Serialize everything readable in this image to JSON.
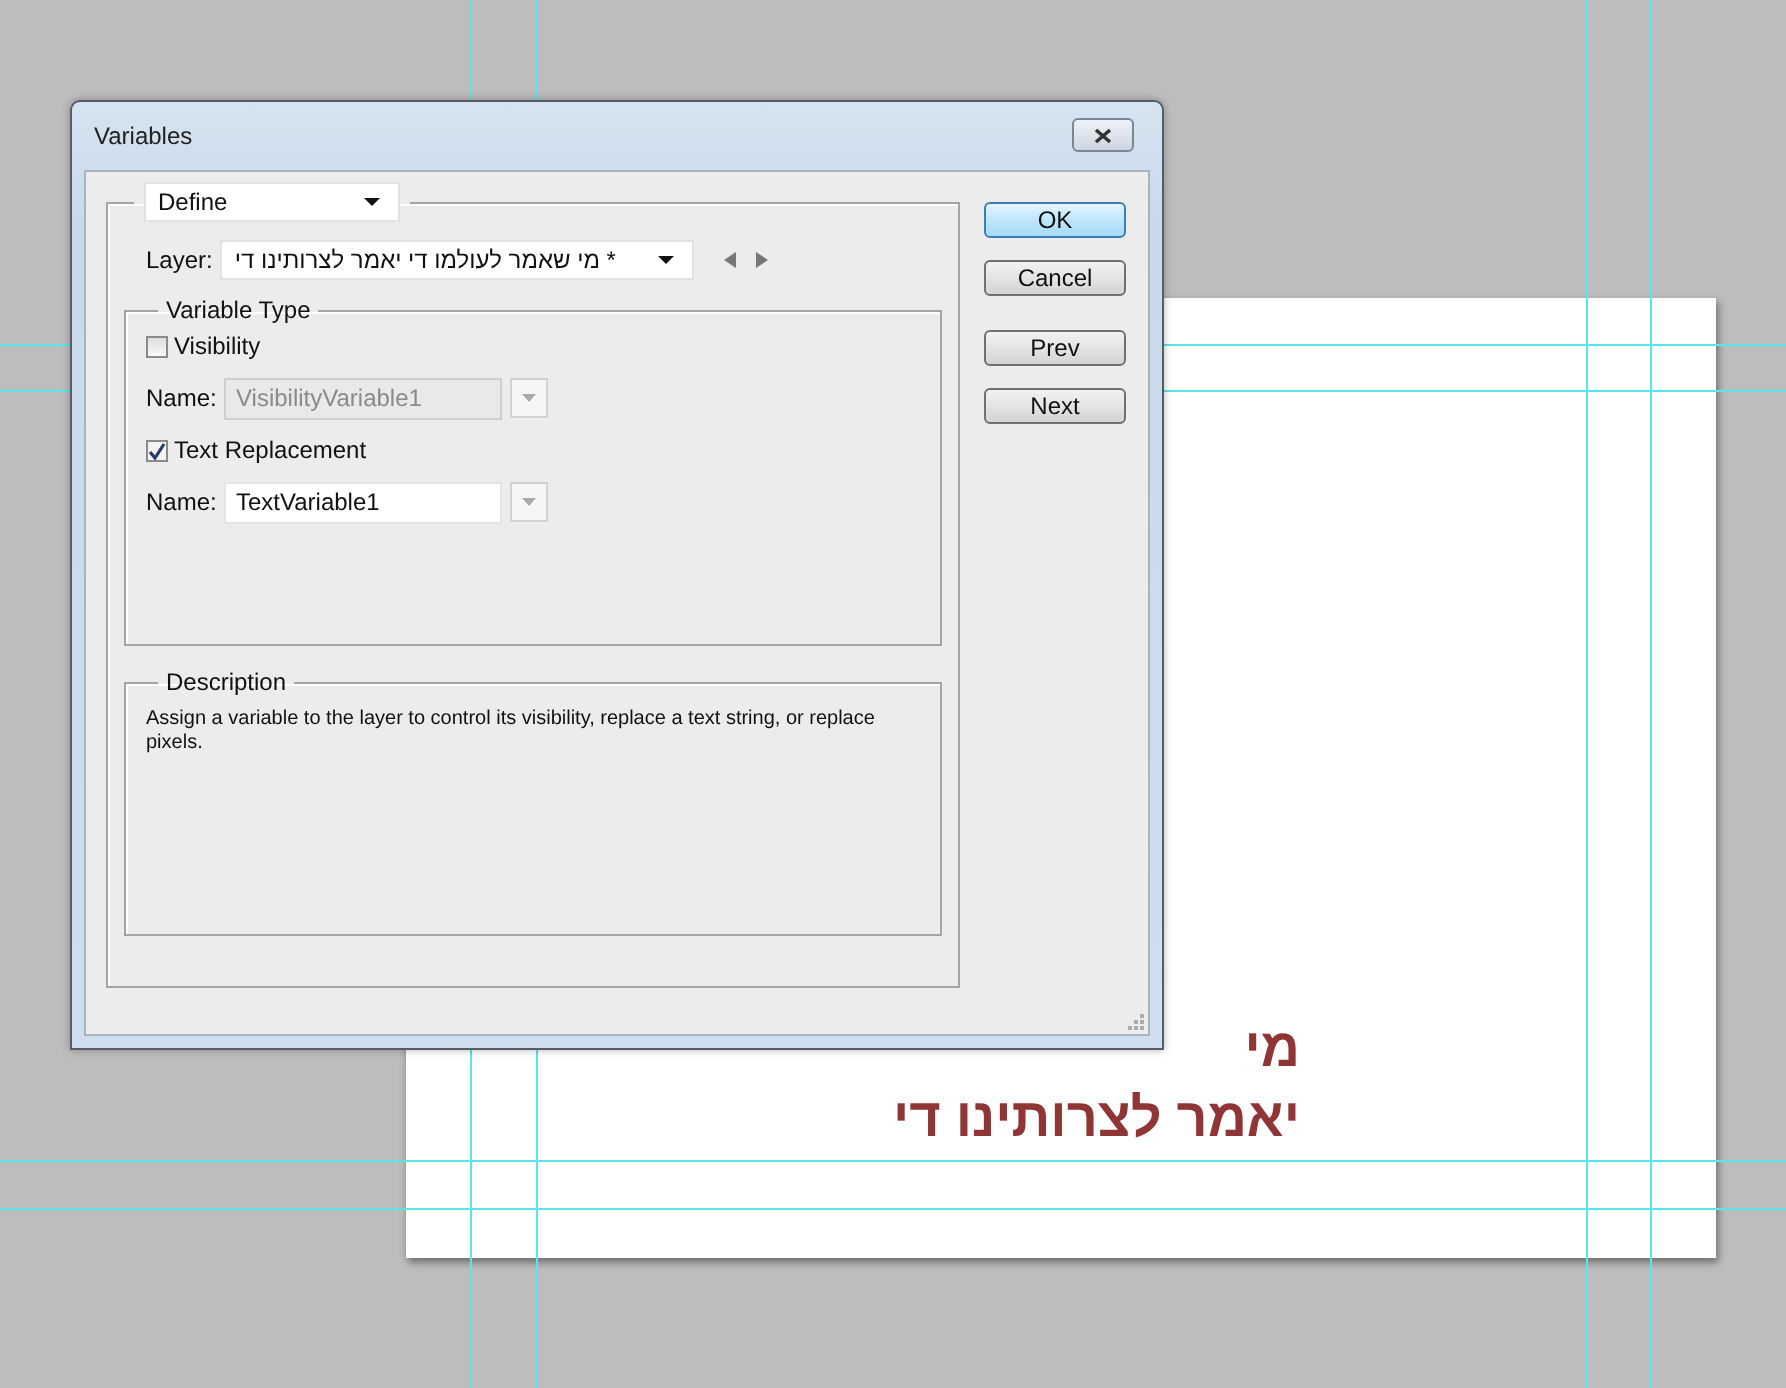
{
  "window": {
    "title": "Variables"
  },
  "mode_dropdown": {
    "value": "Define"
  },
  "layer": {
    "label": "Layer:",
    "value": "מי שאמר לעולמו די יאמר לצרותינו די *"
  },
  "variable_type": {
    "title": "Variable Type",
    "options": [
      {
        "label": "Visibility",
        "checked": false,
        "name_label": "Name:",
        "name_value": "VisibilityVariable1",
        "name_disabled": true
      },
      {
        "label": "Text Replacement",
        "checked": true,
        "name_label": "Name:",
        "name_value": "TextVariable1",
        "name_disabled": false
      }
    ]
  },
  "description": {
    "title": "Description",
    "text": "Assign a variable to the layer to control its visibility, replace a text string, or replace pixels."
  },
  "buttons": [
    {
      "label": "OK",
      "default": true
    },
    {
      "label": "Cancel",
      "default": false
    }
  ],
  "nav_buttons": [
    {
      "label": "Prev"
    },
    {
      "label": "Next"
    }
  ],
  "canvas_text": [
    "מי",
    "יאמר לצרותינו די"
  ]
}
